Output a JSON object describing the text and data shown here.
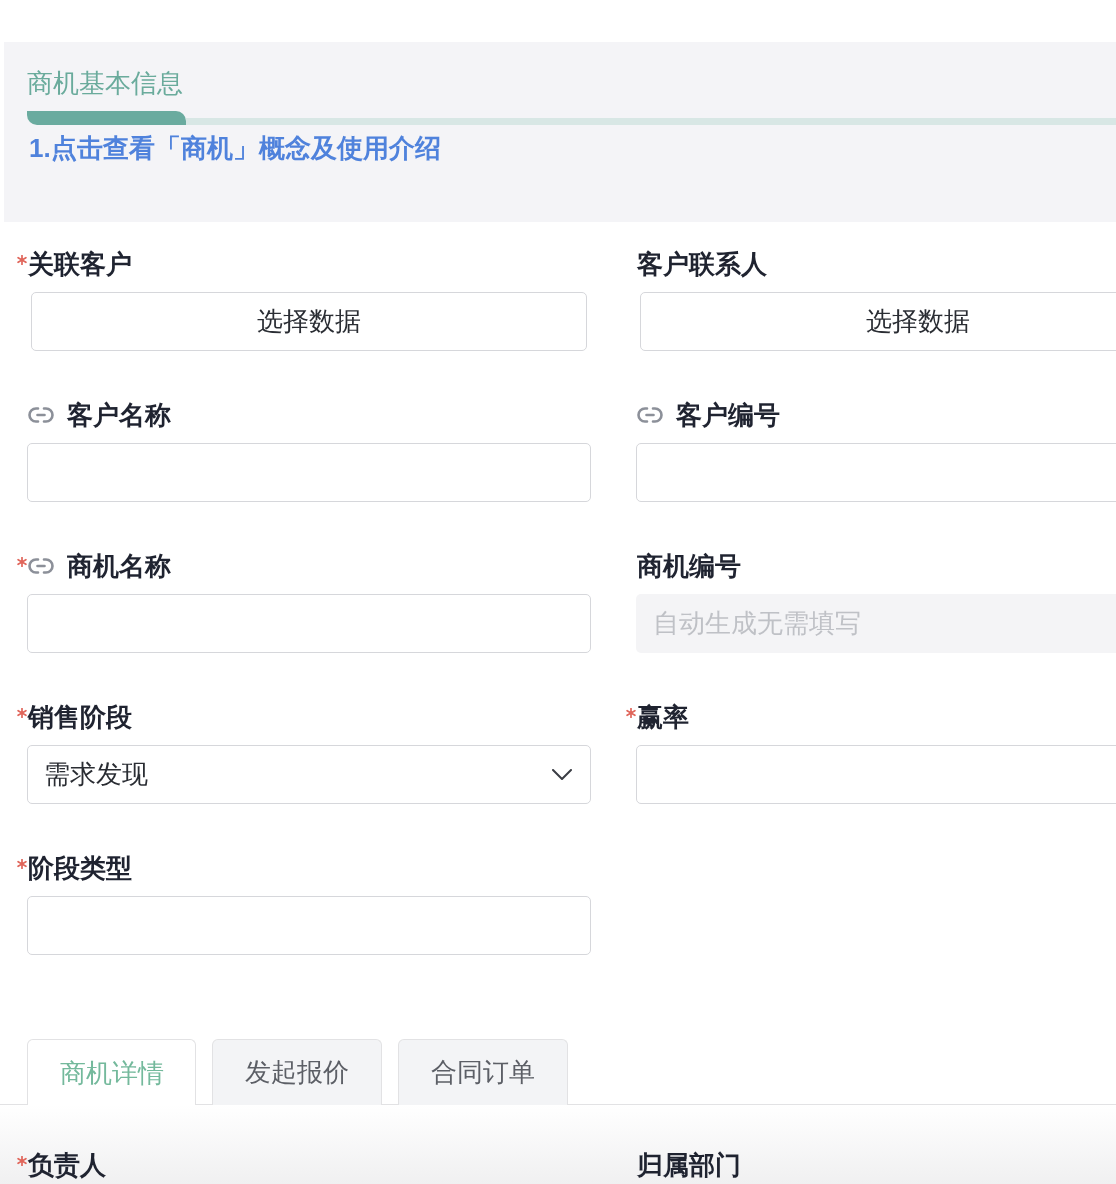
{
  "section": {
    "title": "商机基本信息",
    "guide_link": "1.点击查看「商机」概念及使用介绍"
  },
  "fields": [
    {
      "label": "关联客户",
      "required": true,
      "linked": false,
      "disabled": false,
      "kind": "picker",
      "text": "选择数据"
    },
    {
      "label": "客户联系人",
      "required": false,
      "linked": false,
      "disabled": false,
      "kind": "picker",
      "text": "选择数据"
    },
    {
      "label": "客户名称",
      "required": false,
      "linked": true,
      "disabled": false,
      "kind": "input"
    },
    {
      "label": "客户编号",
      "required": false,
      "linked": true,
      "disabled": false,
      "kind": "input"
    },
    {
      "label": "商机名称",
      "required": true,
      "linked": true,
      "disabled": false,
      "kind": "input"
    },
    {
      "label": "商机编号",
      "required": false,
      "linked": false,
      "disabled": true,
      "kind": "input",
      "placeholder": "自动生成无需填写"
    },
    {
      "label": "销售阶段",
      "required": true,
      "linked": false,
      "disabled": false,
      "kind": "select",
      "value": "需求发现"
    },
    {
      "label": "赢率",
      "required": true,
      "linked": false,
      "disabled": false,
      "kind": "input"
    },
    {
      "label": "阶段类型",
      "required": true,
      "linked": false,
      "disabled": false,
      "kind": "input"
    }
  ],
  "tabs": [
    {
      "label": "商机详情",
      "selected": true
    },
    {
      "label": "发起报价",
      "selected": false
    },
    {
      "label": "合同订单",
      "selected": false
    }
  ],
  "tab_fields": [
    {
      "label": "负责人",
      "required": true
    },
    {
      "label": "归属部门",
      "required": false
    }
  ]
}
